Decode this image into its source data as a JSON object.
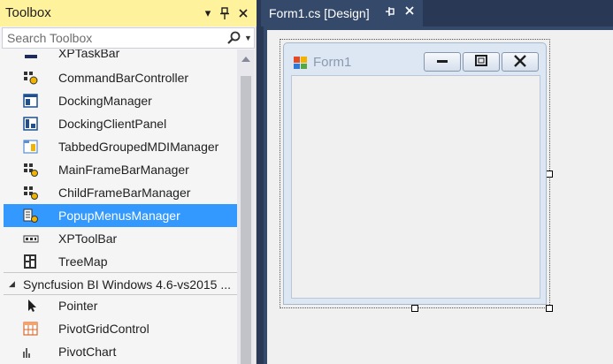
{
  "toolbox": {
    "title": "Toolbox",
    "search_placeholder": "Search Toolbox",
    "items": [
      {
        "label": "XPTaskBar",
        "icon": "taskbar-icon"
      },
      {
        "label": "CommandBarController",
        "icon": "command-bar-controller-icon"
      },
      {
        "label": "DockingManager",
        "icon": "docking-manager-icon"
      },
      {
        "label": "DockingClientPanel",
        "icon": "docking-client-panel-icon"
      },
      {
        "label": "TabbedGroupedMDIManager",
        "icon": "tabbed-mdi-manager-icon"
      },
      {
        "label": "MainFrameBarManager",
        "icon": "mainframe-bar-manager-icon"
      },
      {
        "label": "ChildFrameBarManager",
        "icon": "childframe-bar-manager-icon"
      },
      {
        "label": "PopupMenusManager",
        "icon": "popup-menus-manager-icon",
        "selected": true
      },
      {
        "label": "XPToolBar",
        "icon": "xp-toolbar-icon"
      },
      {
        "label": "TreeMap",
        "icon": "treemap-icon"
      }
    ],
    "group": {
      "label": "Syncfusion BI Windows 4.6-vs2015 ..."
    },
    "group_items": [
      {
        "label": "Pointer",
        "icon": "pointer-icon"
      },
      {
        "label": "PivotGridControl",
        "icon": "pivot-grid-icon"
      },
      {
        "label": "PivotChart",
        "icon": "pivot-chart-icon"
      }
    ]
  },
  "document": {
    "tab_label": "Form1.cs [Design]"
  },
  "form": {
    "title": "Form1"
  },
  "colors": {
    "toolbox_title_bg": "#fff29d",
    "selection_bg": "#3399ff",
    "doc_tab_bg": "#35496a",
    "doc_strip_bg": "#293955"
  }
}
